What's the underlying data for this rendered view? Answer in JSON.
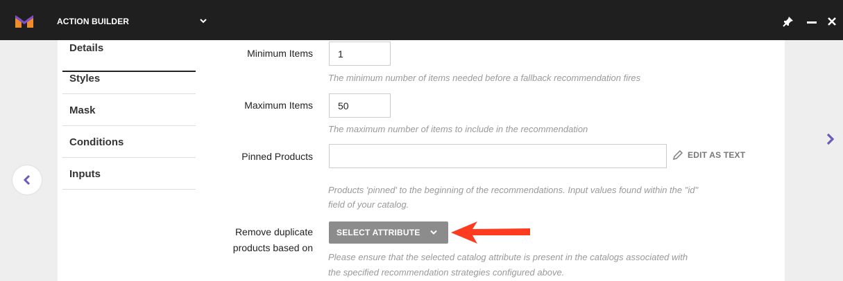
{
  "header": {
    "app_title": "ACTION BUILDER",
    "icons": {
      "logo": "brand-logo",
      "chevron": "chevron-down-icon",
      "pin": "pin-icon",
      "minimize": "minimize-icon",
      "close": "close-icon"
    },
    "colors": {
      "bar": "#1f1f1f",
      "logo_orange": "#f28c28",
      "logo_purple": "#7b4fd1"
    }
  },
  "navigation": {
    "prev_icon": "chevron-left-icon",
    "next_icon": "chevron-right-icon",
    "accent": "#6b5bb8"
  },
  "sidebar": {
    "items": [
      {
        "label": "Details",
        "active": true
      },
      {
        "label": "Styles"
      },
      {
        "label": "Mask"
      },
      {
        "label": "Conditions"
      },
      {
        "label": "Inputs"
      }
    ]
  },
  "form": {
    "minimum_items": {
      "label": "Minimum Items",
      "value": "1",
      "help": "The minimum number of items needed before a fallback recommendation fires"
    },
    "maximum_items": {
      "label": "Maximum Items",
      "value": "50",
      "help": "The maximum number of items to include in the recommendation"
    },
    "pinned_products": {
      "label": "Pinned Products",
      "value": "",
      "edit_as_text": "EDIT AS TEXT",
      "help_line1": "Products 'pinned' to the beginning of the recommendations. Input values found within the \"id\"",
      "help_line2": "field of your catalog."
    },
    "remove_duplicates": {
      "label_line1": "Remove duplicate",
      "label_line2": "products based on",
      "button_label": "SELECT ATTRIBUTE",
      "help_line1": "Please ensure that the selected catalog attribute is present in the catalogs associated with",
      "help_line2": "the specified recommendation strategies configured above."
    }
  },
  "annotation": {
    "arrow_color": "#ff3b1f"
  }
}
